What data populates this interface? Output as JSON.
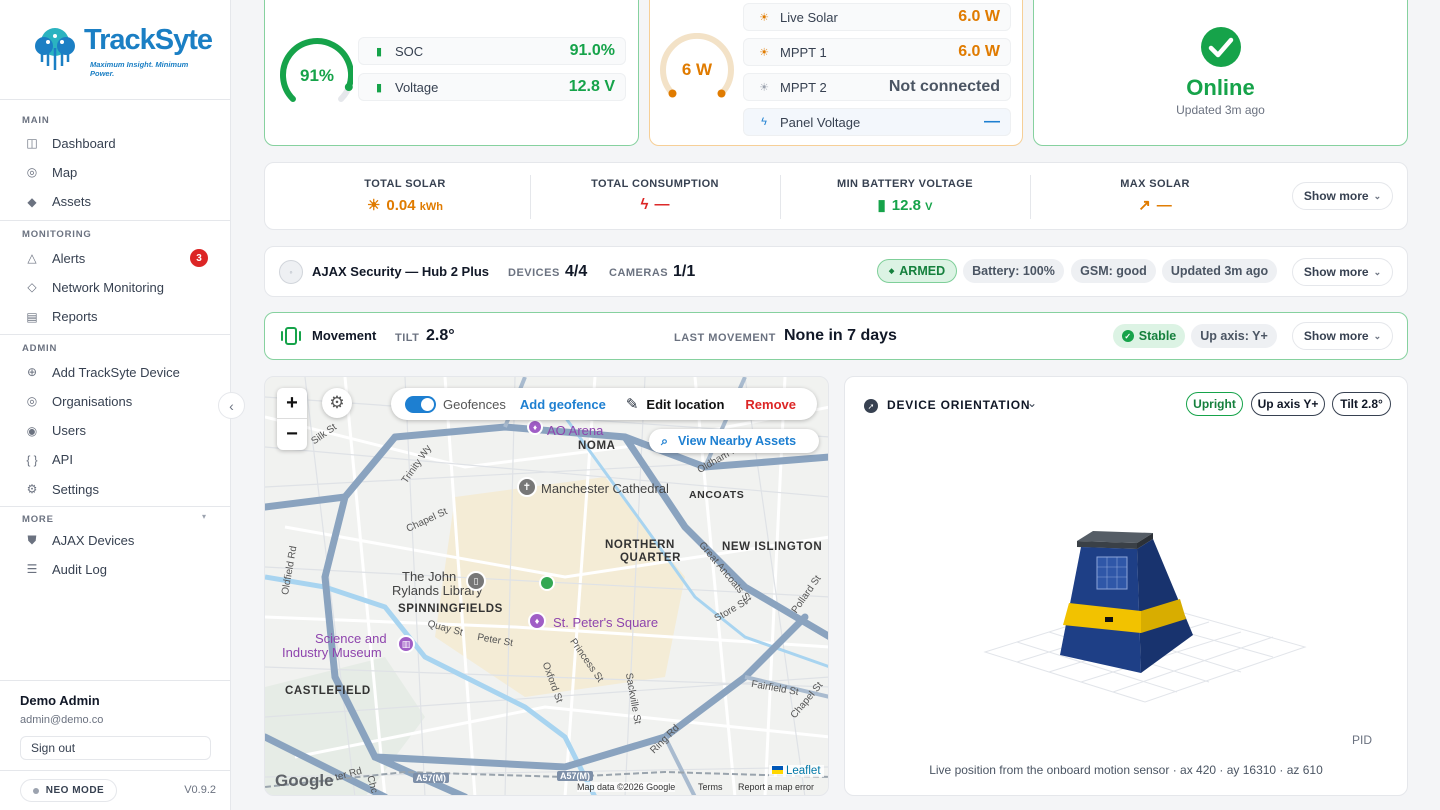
{
  "brand": {
    "name": "TrackSyte",
    "tagline": "Maximum Insight. Minimum Power."
  },
  "nav": {
    "main_title": "MAIN",
    "main": [
      {
        "label": "Dashboard",
        "icon": "grid-icon"
      },
      {
        "label": "Map",
        "icon": "map-pin-icon"
      },
      {
        "label": "Assets",
        "icon": "diamond-icon"
      }
    ],
    "monitoring_title": "MONITORING",
    "monitoring": [
      {
        "label": "Alerts",
        "icon": "warning-icon",
        "badge": "3"
      },
      {
        "label": "Network Monitoring",
        "icon": "network-icon"
      },
      {
        "label": "Reports",
        "icon": "report-icon"
      }
    ],
    "admin_title": "ADMIN",
    "admin": [
      {
        "label": "Add TrackSyte Device",
        "icon": "plus-circle-icon"
      },
      {
        "label": "Organisations",
        "icon": "building-icon"
      },
      {
        "label": "Users",
        "icon": "users-icon"
      },
      {
        "label": "API",
        "icon": "code-icon"
      },
      {
        "label": "Settings",
        "icon": "gear-icon"
      }
    ],
    "more_title": "MORE",
    "more": [
      {
        "label": "AJAX Devices",
        "icon": "shield-icon"
      },
      {
        "label": "Audit Log",
        "icon": "list-icon"
      }
    ]
  },
  "user": {
    "name": "Demo Admin",
    "email": "admin@demo.co",
    "signout": "Sign out"
  },
  "footer": {
    "mode": "NEO MODE",
    "version": "V0.9.2"
  },
  "battery": {
    "gauge": "91%",
    "gauge_level": 0.91,
    "soc_label": "SOC",
    "soc": "91.0%",
    "voltage_label": "Voltage",
    "voltage": "12.8 V",
    "color": "#16a34a"
  },
  "solar": {
    "gauge": "6 W",
    "rows": [
      {
        "label": "Live Solar",
        "value": "6.0 W",
        "color": "#e07b00"
      },
      {
        "label": "MPPT 1",
        "value": "6.0 W",
        "color": "#e07b00"
      },
      {
        "label": "MPPT 2",
        "value": "Not connected",
        "color": "#4b5563"
      },
      {
        "label": "Panel Voltage",
        "value": "—",
        "color": "#1d7fd1"
      }
    ]
  },
  "status": {
    "text": "Online",
    "updated": "Updated 3m ago",
    "color": "#16a34a"
  },
  "stats": [
    {
      "label": "TOTAL SOLAR",
      "value": "0.04",
      "unit": "kWh",
      "color": "#e07b00",
      "icon": "sun-icon"
    },
    {
      "label": "TOTAL CONSUMPTION",
      "value": "—",
      "unit": "",
      "color": "#dc2626",
      "icon": "bolt-icon"
    },
    {
      "label": "MIN BATTERY VOLTAGE",
      "value": "12.8",
      "unit": "V",
      "color": "#16a34a",
      "icon": "battery-icon"
    },
    {
      "label": "MAX SOLAR",
      "value": "—",
      "unit": "",
      "color": "#e07b00",
      "icon": "trend-icon"
    }
  ],
  "show_more": "Show more",
  "ajax": {
    "title": "AJAX Security — Hub 2 Plus",
    "devices_label": "DEVICES",
    "devices": "4/4",
    "cameras_label": "CAMERAS",
    "cameras": "1/1",
    "armed": "ARMED",
    "battery": "Battery: 100%",
    "gsm": "GSM: good",
    "updated": "Updated 3m ago"
  },
  "movement": {
    "title": "Movement",
    "tilt_label": "TILT",
    "tilt": "2.8°",
    "last_label": "LAST MOVEMENT",
    "last": "None in 7 days",
    "stable": "Stable",
    "upaxis": "Up axis: Y+"
  },
  "map": {
    "zoom_in": "+",
    "zoom_out": "−",
    "geofences": "Geofences",
    "add_geofence": "Add geofence",
    "edit_location": "Edit location",
    "remove": "Remove",
    "nearby": "View Nearby Assets",
    "areas": [
      "NOMA",
      "ANCOATS",
      "NORTHERN",
      "QUARTER",
      "NEW ISLINGTON",
      "SPINNINGFIELDS",
      "CASTLEFIELD"
    ],
    "pois": [
      "AO Arena",
      "Manchester Cathedral",
      "The John",
      "Rylands Library",
      "St. Peter's Square",
      "Science and",
      "Industry Museum"
    ],
    "streets": [
      "Silk St",
      "Trinity Wy",
      "Chapel St",
      "Oldfield Rd",
      "Quay St",
      "Peter St",
      "Oxford St",
      "Princess St",
      "Sackville St",
      "Ring Rd",
      "Great Ancoats St",
      "Store St",
      "Pollard St",
      "Fairfield St",
      "Oldham Rd",
      "Chapel St",
      "A57(M)",
      "A57(M)",
      "ter Rd",
      "Chc"
    ],
    "attribution_google": "Google",
    "attribution_data": "Map data ©2026 Google",
    "terms": "Terms",
    "report": "Report a map error",
    "leaflet": "Leaflet"
  },
  "orientation": {
    "title": "DEVICE ORIENTATION",
    "chips": [
      "Upright",
      "Up axis Y+",
      "Tilt 2.8°"
    ],
    "pid": "PID",
    "footer": "Live position from the onboard motion sensor · ax 420 · ay 16310 · az 610"
  }
}
